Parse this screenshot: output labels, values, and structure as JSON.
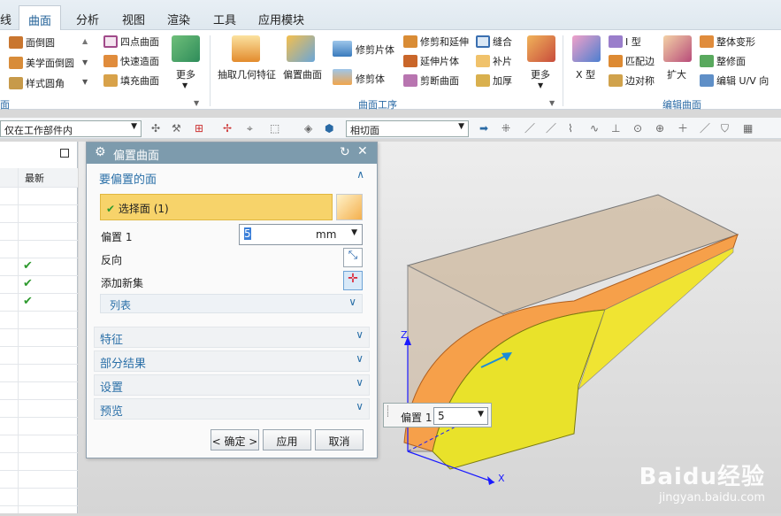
{
  "tabs": [
    {
      "label": "线"
    },
    {
      "label": "曲面"
    },
    {
      "label": "分析"
    },
    {
      "label": "视图"
    },
    {
      "label": "渲染"
    },
    {
      "label": "工具"
    },
    {
      "label": "应用模块"
    }
  ],
  "ribbon": {
    "col1": [
      "面倒圆",
      "美学面倒圆",
      "样式圆角"
    ],
    "col2": [
      "四点曲面",
      "快速造面",
      "填充曲面"
    ],
    "more1": "更多",
    "extract": "抽取几何特征",
    "offset": "偏置曲面",
    "trim_sheet": "修剪片体",
    "trim_body": "修剪体",
    "col3": [
      "修剪和延伸",
      "延伸片体",
      "剪断曲面"
    ],
    "col4": [
      "缝合",
      "补片",
      "加厚"
    ],
    "more2": "更多",
    "xtype": "X 型",
    "col5": [
      "I 型",
      "匹配边",
      "边对称"
    ],
    "enlarge": "扩大",
    "col6": [
      "整体变形",
      "整修面",
      "编辑 U/V 向"
    ],
    "group_left": "面",
    "group_mid": "曲面工序",
    "group_right": "编辑曲面"
  },
  "toolbar": {
    "filter": "仅在工作部件内",
    "snap": "相切面"
  },
  "leftnav": {
    "header": "最新",
    "checks": 3
  },
  "dialog": {
    "title": "偏置曲面",
    "section_face": "要偏置的面",
    "select_face": "选择面 (1)",
    "offset_label": "偏置 1",
    "offset_value": "5",
    "unit": "mm",
    "reverse": "反向",
    "add_set": "添加新集",
    "list": "列表",
    "sections": [
      "特征",
      "部分结果",
      "设置",
      "预览"
    ],
    "ok": "< 确定 >",
    "apply": "应用",
    "cancel": "取消"
  },
  "float": {
    "label": "偏置 1",
    "value": "5"
  },
  "axes": {
    "z": "Z",
    "x": "X"
  },
  "watermark": {
    "brand": "Baidu经验",
    "url": "jingyan.baidu.com"
  },
  "colors": {
    "accent": "#2b70a8",
    "select_bar": "#f7d36a",
    "surface_orange": "#f6a04a",
    "surface_yellow": "#e9e22a",
    "sheet": "#cdb89e"
  }
}
